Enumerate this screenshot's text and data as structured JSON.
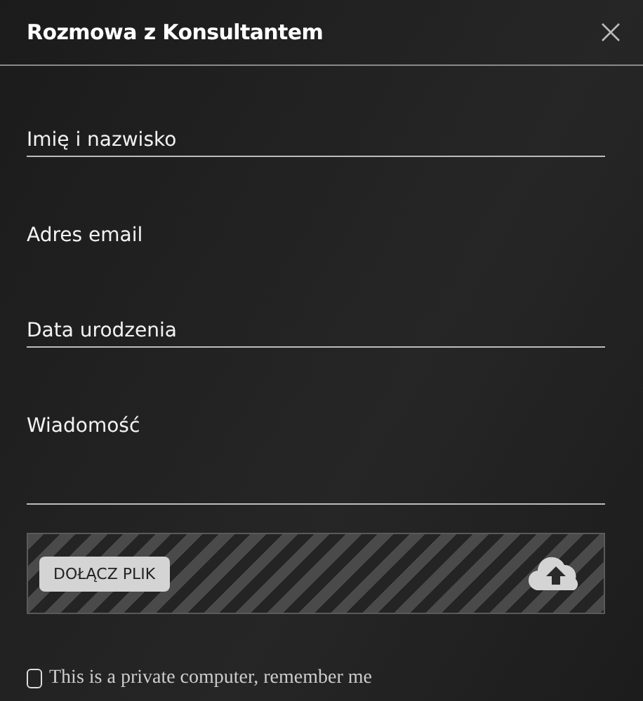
{
  "dialog": {
    "title": "Rozmowa z Konsultantem"
  },
  "fields": [
    {
      "kind": "line",
      "placeholder": "Imię i nazwisko"
    },
    {
      "kind": "plain",
      "placeholder": "Adres email"
    },
    {
      "kind": "line",
      "placeholder": "Data urodzenia"
    },
    {
      "kind": "area",
      "placeholder": "Wiadomość"
    }
  ],
  "upload": {
    "button": "DOŁĄCZ PLIK"
  },
  "remember": {
    "label": "This is a private computer, remember me",
    "checked": false
  }
}
